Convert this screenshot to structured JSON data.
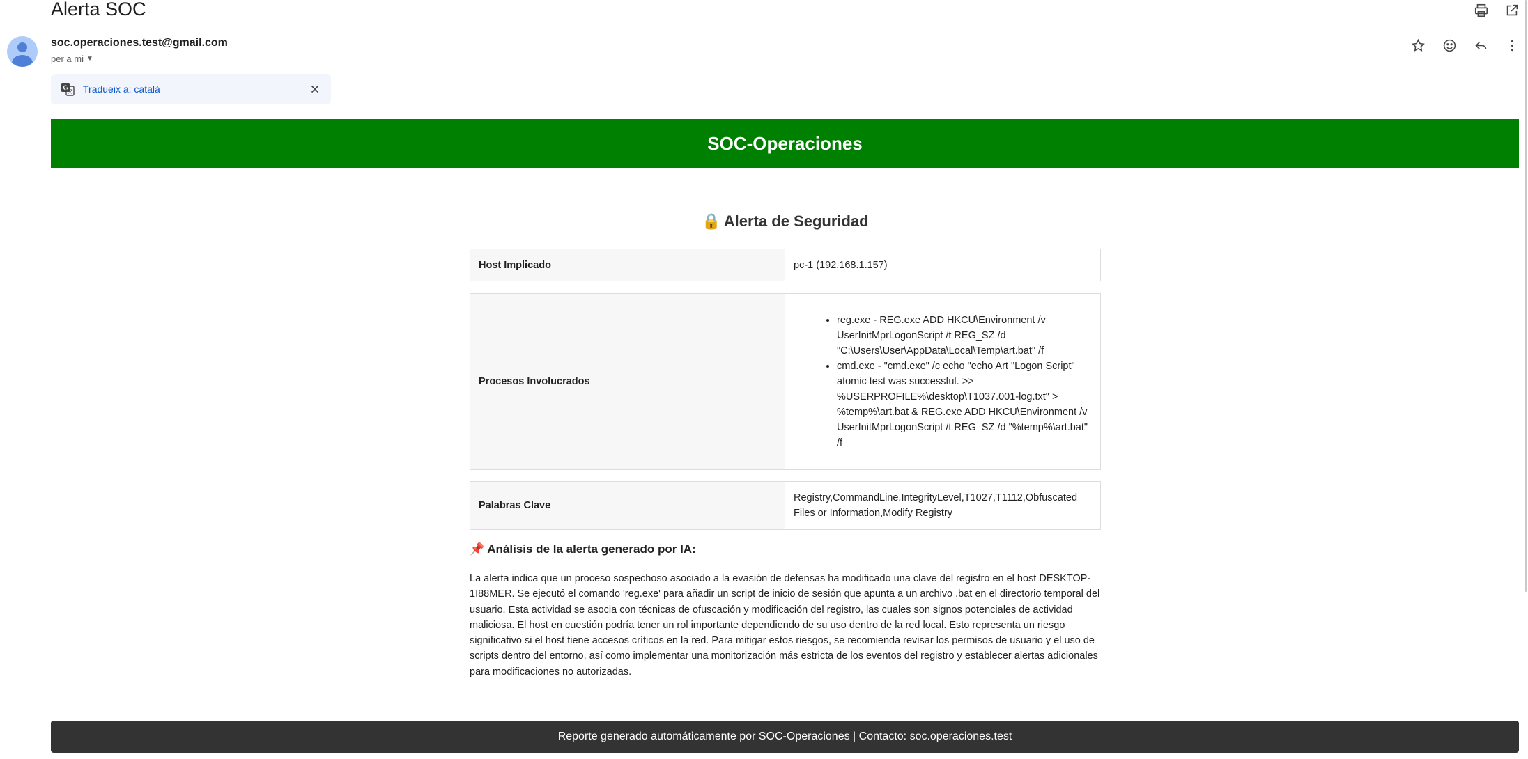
{
  "email": {
    "subject": "Alerta SOC",
    "sender": "soc.operaciones.test@gmail.com",
    "recipient": "per a mi",
    "translate_label": "Tradueix a: català"
  },
  "report": {
    "header": "SOC-Operaciones",
    "alert_title": "Alerta de Seguridad",
    "alert_emoji": "🔒",
    "rows": [
      {
        "key": "Host Implicado",
        "value": "pc-1 (192.168.1.157)"
      },
      {
        "key": "Procesos Involucrados",
        "items": [
          "reg.exe - REG.exe ADD HKCU\\Environment /v UserInitMprLogonScript /t REG_SZ /d \"C:\\Users\\User\\AppData\\Local\\Temp\\art.bat\" /f",
          "cmd.exe - \"cmd.exe\" /c echo \"echo Art \"Logon Script\" atomic test was successful. >> %USERPROFILE%\\desktop\\T1037.001-log.txt\" > %temp%\\art.bat & REG.exe ADD HKCU\\Environment /v UserInitMprLogonScript /t REG_SZ /d \"%temp%\\art.bat\" /f"
        ]
      },
      {
        "key": "Palabras Clave",
        "value": "Registry,CommandLine,IntegrityLevel,T1027,T1112,Obfuscated Files or Information,Modify Registry"
      }
    ],
    "analysis_emoji": "📌",
    "analysis_title": "Análisis de la alerta generado por IA:",
    "analysis_text": "La alerta indica que un proceso sospechoso asociado a la evasión de defensas ha modificado una clave del registro en el host DESKTOP-1I88MER. Se ejecutó el comando 'reg.exe' para añadir un script de inicio de sesión que apunta a un archivo .bat en el directorio temporal del usuario. Esta actividad se asocia con técnicas de ofuscación y modificación del registro, las cuales son signos potenciales de actividad maliciosa. El host en cuestión podría tener un rol importante dependiendo de su uso dentro de la red local. Esto representa un riesgo significativo si el host tiene accesos críticos en la red. Para mitigar estos riesgos, se recomienda revisar los permisos de usuario y el uso de scripts dentro del entorno, así como implementar una monitorización más estricta de los eventos del registro y establecer alertas adicionales para modificaciones no autorizadas.",
    "footer": "Reporte generado automáticamente por SOC-Operaciones | Contacto: soc.operaciones.test"
  },
  "icons": {
    "top": [
      "print-icon",
      "open-in-new-window-icon"
    ],
    "message": [
      "star-icon",
      "emoji-reaction-icon",
      "reply-icon",
      "more-vert-icon"
    ]
  },
  "colors": {
    "banner": "#008000",
    "footer": "#333333",
    "translate_bar": "#f2f6fc",
    "link": "#0b57d0"
  }
}
